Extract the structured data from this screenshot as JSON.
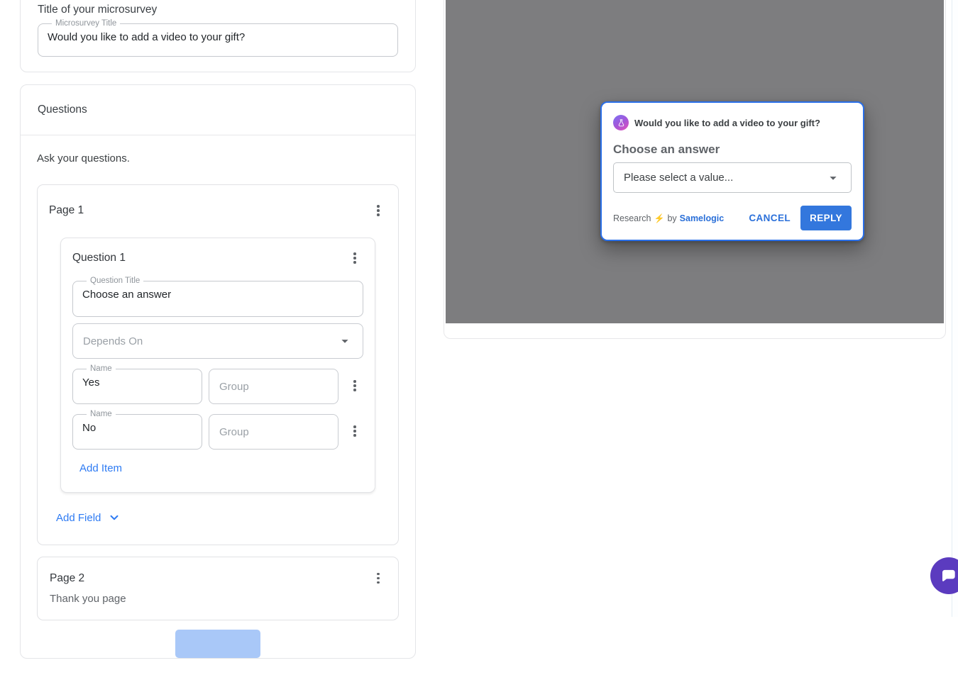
{
  "colors": {
    "accent_blue": "#2e7bf3",
    "modal_border": "#2a6fe8",
    "reply_button": "#3377dd",
    "backdrop_gray": "#7d7d7f",
    "chat_purple": "#5b3bbf",
    "add_page_blue": "#a9c8f8"
  },
  "title_panel": {
    "heading": "Title of your microsurvey",
    "field_label": "Microsurvey Title",
    "field_value": "Would you like to add a video to your gift?"
  },
  "questions_panel": {
    "heading": "Questions",
    "subheading": "Ask your questions.",
    "page1": {
      "title": "Page 1",
      "question": {
        "title": "Question 1",
        "question_title_label": "Question Title",
        "question_title_value": "Choose an answer",
        "depends_on_placeholder": "Depends On",
        "items": [
          {
            "name_label": "Name",
            "name_value": "Yes",
            "group_placeholder": "Group"
          },
          {
            "name_label": "Name",
            "name_value": "No",
            "group_placeholder": "Group"
          }
        ],
        "add_item_label": "Add Item"
      },
      "add_field_label": "Add Field"
    },
    "page2": {
      "title": "Page 2",
      "subtitle": "Thank you page"
    }
  },
  "preview": {
    "modal": {
      "question": "Would you like to add a video to your gift?",
      "prompt": "Choose an answer",
      "select_placeholder": "Please select a value...",
      "footer_research": "Research",
      "footer_bolt": "⚡",
      "footer_by": "by",
      "footer_brand": "Samelogic",
      "cancel_label": "CANCEL",
      "reply_label": "REPLY"
    }
  }
}
